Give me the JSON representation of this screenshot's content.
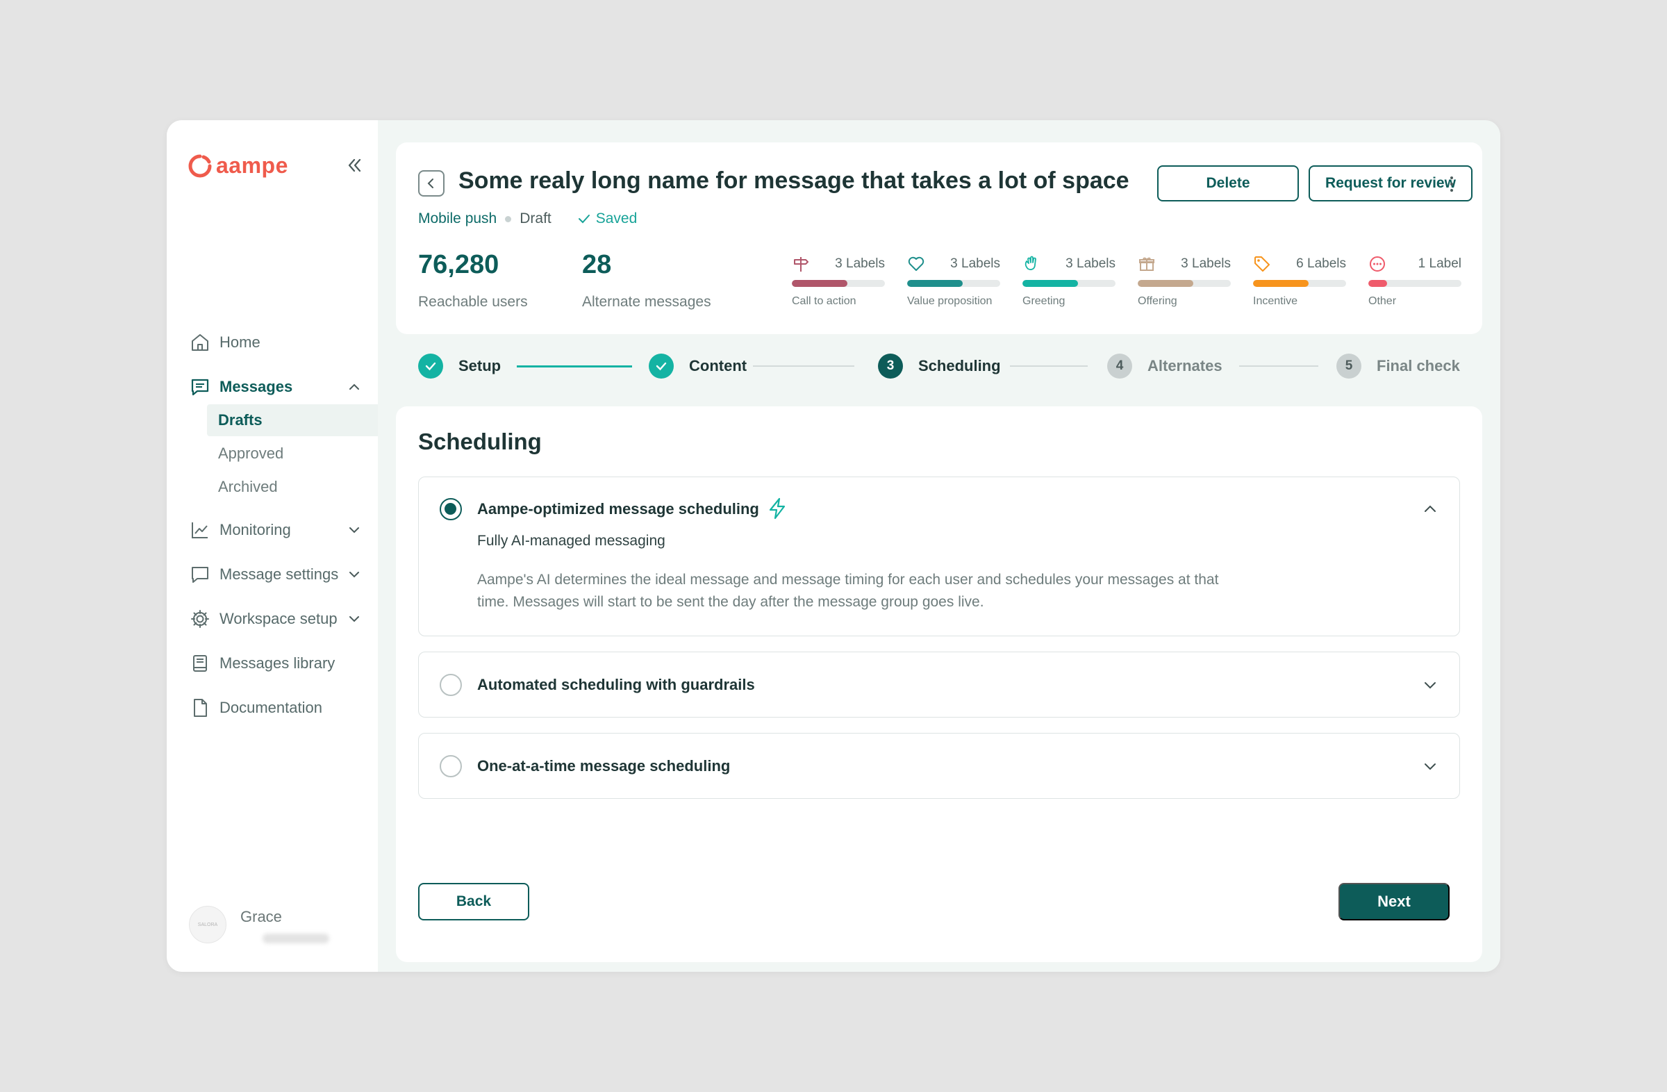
{
  "sidebar": {
    "logo": "aampe",
    "nav": [
      {
        "label": "Home",
        "icon": "home-icon"
      },
      {
        "label": "Messages",
        "icon": "messages-icon"
      },
      {
        "label": "Monitoring",
        "icon": "chart-icon"
      },
      {
        "label": "Message settings",
        "icon": "chat-settings-icon"
      },
      {
        "label": "Workspace setup",
        "icon": "gear-icon"
      },
      {
        "label": "Messages library",
        "icon": "book-icon"
      },
      {
        "label": "Documentation",
        "icon": "document-icon"
      }
    ],
    "messages_sub": [
      "Drafts",
      "Approved",
      "Archived"
    ],
    "user": {
      "name": "Grace",
      "avatar_text": "SALORA"
    }
  },
  "header": {
    "title": "Some realy long name for message that takes a lot of space",
    "channel": "Mobile push",
    "status": "Draft",
    "saved": "Saved",
    "delete_label": "Delete",
    "review_label": "Request for review",
    "metrics": [
      {
        "value": "76,280",
        "label": "Reachable users"
      },
      {
        "value": "28",
        "label": "Alternate messages"
      }
    ],
    "label_groups": [
      {
        "count": "3 Labels",
        "name": "Call to action",
        "fill": 0.6,
        "color": "#b0566a",
        "icon": "signpost-icon"
      },
      {
        "count": "3 Labels",
        "name": "Value proposition",
        "fill": 0.6,
        "color": "#1f8f8c",
        "icon": "heart-icon"
      },
      {
        "count": "3 Labels",
        "name": "Greeting",
        "fill": 0.6,
        "color": "#14b3a3",
        "icon": "wave-hand-icon"
      },
      {
        "count": "3 Labels",
        "name": "Offering",
        "fill": 0.6,
        "color": "#c4a88e",
        "icon": "gift-icon"
      },
      {
        "count": "6 Labels",
        "name": "Incentive",
        "fill": 0.6,
        "color": "#f7941d",
        "icon": "tag-icon"
      },
      {
        "count": "1 Label",
        "name": "Other",
        "fill": 0.2,
        "color": "#ef5b6b",
        "icon": "more-circle-icon"
      }
    ]
  },
  "stepper": [
    {
      "label": "Setup",
      "num": "",
      "state": "done"
    },
    {
      "label": "Content",
      "num": "",
      "state": "done"
    },
    {
      "label": "Scheduling",
      "num": "3",
      "state": "current"
    },
    {
      "label": "Alternates",
      "num": "4",
      "state": "todo"
    },
    {
      "label": "Final check",
      "num": "5",
      "state": "todo"
    }
  ],
  "main": {
    "title": "Scheduling",
    "options": [
      {
        "title": "Aampe-optimized message scheduling",
        "subtitle": "Fully AI-managed messaging",
        "description": "Aampe's AI determines the ideal message and message timing for each user and schedules your messages at that time. Messages will start to be sent the day after the message group goes live.",
        "selected": true
      },
      {
        "title": "Automated scheduling with guardrails",
        "selected": false
      },
      {
        "title": "One-at-a-time message scheduling",
        "selected": false
      }
    ],
    "back_label": "Back",
    "next_label": "Next"
  },
  "colors": {
    "primary": "#0d5c59",
    "accent": "#14b3a3",
    "brand": "#ef5b4c"
  }
}
